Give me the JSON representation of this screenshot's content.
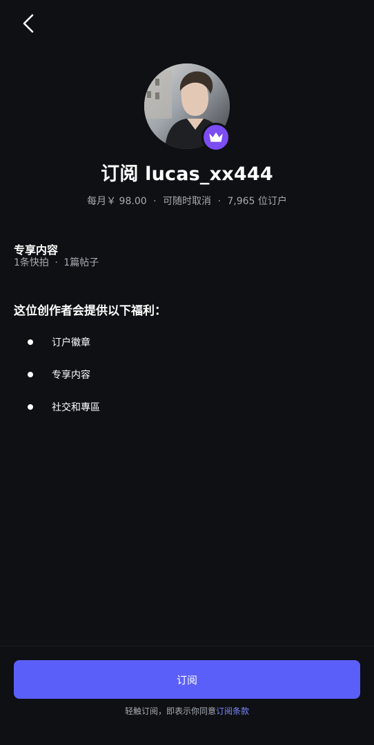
{
  "nav": {
    "back_icon": "chevron-left-icon"
  },
  "profile": {
    "avatar_alt": "creator avatar",
    "badge_icon": "crown-icon",
    "badge_color": "#7b4df2"
  },
  "header": {
    "title": "订阅 lucas_xx444",
    "price": "每月￥ 98.00",
    "cancel_note": "可随时取消",
    "subscribers": "7,965 位订户",
    "separator": "·"
  },
  "exclusive": {
    "title": "专享内容",
    "snaps": "1条快拍",
    "posts": "1篇帖子",
    "separator": "·"
  },
  "benefits": {
    "title": "这位创作者会提供以下福利：",
    "items": [
      {
        "label": "订户徽章"
      },
      {
        "label": "专享内容"
      },
      {
        "label": "社交和專區"
      }
    ]
  },
  "footer": {
    "subscribe_label": "订阅",
    "terms_prefix": "轻触订阅，即表示你同意",
    "terms_link": "订阅条款",
    "button_color": "#5b5ff9"
  }
}
